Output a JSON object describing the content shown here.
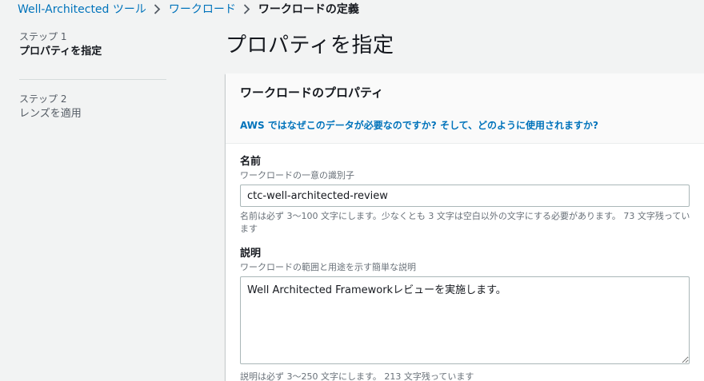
{
  "breadcrumb": {
    "items": [
      {
        "label": "Well-Architected ツール"
      },
      {
        "label": "ワークロード"
      },
      {
        "label": "ワークロードの定義"
      }
    ]
  },
  "steps": [
    {
      "number": "ステップ 1",
      "title": "プロパティを指定"
    },
    {
      "number": "ステップ 2",
      "title": "レンズを適用"
    }
  ],
  "page": {
    "title": "プロパティを指定"
  },
  "panel": {
    "title": "ワークロードのプロパティ",
    "info_link": "AWS ではなぜこのデータが必要なのですか? そして、どのように使用されますか?"
  },
  "fields": {
    "name": {
      "label": "名前",
      "description": "ワークロードの一意の識別子",
      "value": "ctc-well-architected-review",
      "constraint": "名前は必ず 3〜100 文字にします。少なくとも 3 文字は空白以外の文字にする必要があります。 73 文字残っています"
    },
    "description": {
      "label": "説明",
      "description": "ワークロードの範囲と用途を示す簡単な説明",
      "value": "Well Architected Frameworkレビューを実施します。",
      "constraint": "説明は必ず 3〜250 文字にします。 213 文字残っています"
    }
  },
  "colors": {
    "link": "#0073bb",
    "background": "#f2f3f3",
    "text": "#16191f"
  }
}
